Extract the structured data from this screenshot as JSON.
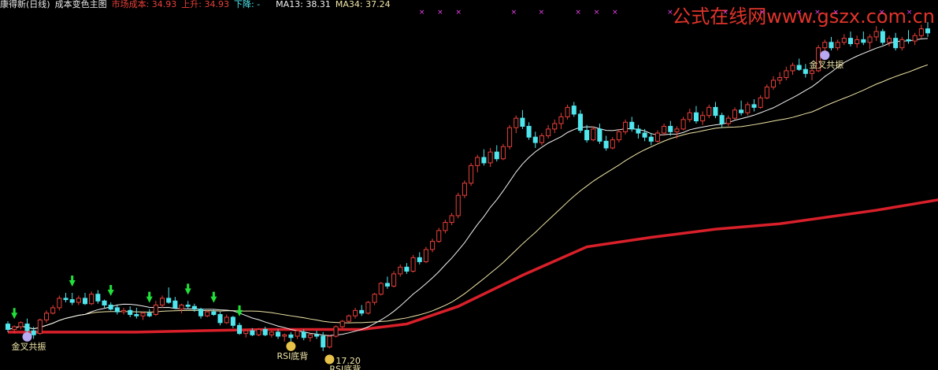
{
  "header": {
    "title": "康得新(日线)",
    "indicator_name": "成本变色主图",
    "market_cost": "市场成本: 34.93",
    "rise": "上升: 34.93",
    "fall": "下降: -",
    "ma13": "MA13: 38.31",
    "ma34": "MA34: 37.24"
  },
  "watermark": "公式在线网www.gszx.com.cn",
  "colors": {
    "background": "#000000",
    "up_candle": "#e8403a",
    "down_candle": "#4fe6ee",
    "ma13": "#f2f2f2",
    "ma34": "#f0e6a8",
    "cost_line": "#d9202a",
    "arrow": "#22e03a",
    "marker": "#ee44ee",
    "signal_text": "#f0e6a8"
  },
  "chart_data": {
    "type": "candlestick",
    "title": "康得新(日线)",
    "visible_y_range": [
      16.5,
      41.5
    ],
    "legend_values": {
      "market_cost": 34.93,
      "rise": 34.93,
      "fall": null,
      "ma13": 38.31,
      "ma34": 37.24
    },
    "cost_line_approx": [
      [
        0,
        18.6
      ],
      [
        20,
        18.6
      ],
      [
        40,
        18.8
      ],
      [
        55,
        18.8
      ],
      [
        62,
        19.2
      ],
      [
        70,
        20.5
      ],
      [
        80,
        22.8
      ],
      [
        90,
        24.9
      ],
      [
        100,
        25.6
      ],
      [
        110,
        26.2
      ],
      [
        120,
        26.6
      ],
      [
        135,
        27.6
      ],
      [
        145,
        28.4
      ],
      [
        155,
        29.6
      ],
      [
        165,
        30.5
      ],
      [
        173,
        31.0
      ]
    ],
    "signals": [
      {
        "label": "金叉共振",
        "index": 3
      },
      {
        "label": "RSI底背",
        "index": 44
      },
      {
        "label": "RSI底背",
        "index": 50
      },
      {
        "label": "金叉共振",
        "index": 127
      }
    ],
    "price_label": {
      "text": "17.20",
      "value": 17.2,
      "index": 50
    },
    "ohlc": [
      [
        19.2,
        19.4,
        18.6,
        18.8
      ],
      [
        18.8,
        19.1,
        18.5,
        19.0
      ],
      [
        19.0,
        19.4,
        18.8,
        19.3
      ],
      [
        19.2,
        19.6,
        18.6,
        18.7
      ],
      [
        18.7,
        19.0,
        18.1,
        18.4
      ],
      [
        18.5,
        19.6,
        18.4,
        19.5
      ],
      [
        19.5,
        20.2,
        19.3,
        20.0
      ],
      [
        20.0,
        20.6,
        19.9,
        20.4
      ],
      [
        20.4,
        21.3,
        20.2,
        21.1
      ],
      [
        21.1,
        21.5,
        20.8,
        21.0
      ],
      [
        21.0,
        21.5,
        20.6,
        20.8
      ],
      [
        20.8,
        21.3,
        20.6,
        21.1
      ],
      [
        21.1,
        21.5,
        20.6,
        20.7
      ],
      [
        20.7,
        21.6,
        20.6,
        21.4
      ],
      [
        21.4,
        21.7,
        20.7,
        20.9
      ],
      [
        20.9,
        21.0,
        20.4,
        20.6
      ],
      [
        20.6,
        20.8,
        20.2,
        20.3
      ],
      [
        20.4,
        20.6,
        19.9,
        20.1
      ],
      [
        20.1,
        20.4,
        19.9,
        20.2
      ],
      [
        20.2,
        20.5,
        19.7,
        19.9
      ],
      [
        19.9,
        20.4,
        19.6,
        19.8
      ],
      [
        19.8,
        20.1,
        19.5,
        20.0
      ],
      [
        20.0,
        20.3,
        19.7,
        19.8
      ],
      [
        19.9,
        20.9,
        19.8,
        20.6
      ],
      [
        20.6,
        21.3,
        20.4,
        21.1
      ],
      [
        21.1,
        21.9,
        20.7,
        20.8
      ],
      [
        20.9,
        21.2,
        20.3,
        20.4
      ],
      [
        20.3,
        20.7,
        20.0,
        20.6
      ],
      [
        20.6,
        20.9,
        20.3,
        20.5
      ],
      [
        20.5,
        20.7,
        20.1,
        20.3
      ],
      [
        20.3,
        20.4,
        19.6,
        19.8
      ],
      [
        19.8,
        20.2,
        19.7,
        20.1
      ],
      [
        20.1,
        20.3,
        19.8,
        19.9
      ],
      [
        19.9,
        20.1,
        19.1,
        19.3
      ],
      [
        19.3,
        19.9,
        19.2,
        19.7
      ],
      [
        19.7,
        19.8,
        18.9,
        19.1
      ],
      [
        19.1,
        19.3,
        18.4,
        18.5
      ],
      [
        18.5,
        18.8,
        18.2,
        18.7
      ],
      [
        18.7,
        18.9,
        18.3,
        18.4
      ],
      [
        18.4,
        18.9,
        18.3,
        18.8
      ],
      [
        18.8,
        19.0,
        18.3,
        18.4
      ],
      [
        18.4,
        18.7,
        18.2,
        18.6
      ],
      [
        18.6,
        18.8,
        18.1,
        18.3
      ],
      [
        18.3,
        18.5,
        17.9,
        18.4
      ],
      [
        18.4,
        18.6,
        17.9,
        18.2
      ],
      [
        18.3,
        18.8,
        18.1,
        18.7
      ],
      [
        18.6,
        18.8,
        18.0,
        18.2
      ],
      [
        18.2,
        18.5,
        17.9,
        18.4
      ],
      [
        18.4,
        18.7,
        18.1,
        18.3
      ],
      [
        18.3,
        18.6,
        17.2,
        17.5
      ],
      [
        17.5,
        18.4,
        17.4,
        18.3
      ],
      [
        18.3,
        19.1,
        18.2,
        19.0
      ],
      [
        19.0,
        19.5,
        18.9,
        19.4
      ],
      [
        19.4,
        19.9,
        19.3,
        19.8
      ],
      [
        19.8,
        20.4,
        19.6,
        20.2
      ],
      [
        20.2,
        20.6,
        19.8,
        20.0
      ],
      [
        20.0,
        20.9,
        19.9,
        20.8
      ],
      [
        20.8,
        21.5,
        20.6,
        21.4
      ],
      [
        21.4,
        22.3,
        21.3,
        22.2
      ],
      [
        22.2,
        22.7,
        21.8,
        22.0
      ],
      [
        22.0,
        23.1,
        21.9,
        22.9
      ],
      [
        22.9,
        23.6,
        22.7,
        23.4
      ],
      [
        23.4,
        23.7,
        22.9,
        23.1
      ],
      [
        23.1,
        24.3,
        23.0,
        24.1
      ],
      [
        24.1,
        24.5,
        23.6,
        23.8
      ],
      [
        23.8,
        24.9,
        23.7,
        24.7
      ],
      [
        24.7,
        25.5,
        24.5,
        25.3
      ],
      [
        25.3,
        26.3,
        25.2,
        26.1
      ],
      [
        26.1,
        26.9,
        25.9,
        26.7
      ],
      [
        26.7,
        27.4,
        26.5,
        27.2
      ],
      [
        27.2,
        28.9,
        27.0,
        28.7
      ],
      [
        28.7,
        29.8,
        28.5,
        29.6
      ],
      [
        29.6,
        31.1,
        29.4,
        30.9
      ],
      [
        30.9,
        31.7,
        30.4,
        31.5
      ],
      [
        31.5,
        32.1,
        30.9,
        31.1
      ],
      [
        31.1,
        32.2,
        30.8,
        31.9
      ],
      [
        31.9,
        32.4,
        31.2,
        31.4
      ],
      [
        31.4,
        32.5,
        31.3,
        32.3
      ],
      [
        32.3,
        33.9,
        32.1,
        33.7
      ],
      [
        33.7,
        34.6,
        33.3,
        34.4
      ],
      [
        34.4,
        35.0,
        33.6,
        33.8
      ],
      [
        33.8,
        34.1,
        32.8,
        33.0
      ],
      [
        33.0,
        33.4,
        32.2,
        32.6
      ],
      [
        32.6,
        33.3,
        32.4,
        33.1
      ],
      [
        33.1,
        33.9,
        32.9,
        33.6
      ],
      [
        33.6,
        34.3,
        33.3,
        34.0
      ],
      [
        34.0,
        34.8,
        33.6,
        34.5
      ],
      [
        34.5,
        35.4,
        34.3,
        35.2
      ],
      [
        35.3,
        35.6,
        34.5,
        34.7
      ],
      [
        34.7,
        35.0,
        33.3,
        33.5
      ],
      [
        33.5,
        33.9,
        32.6,
        32.8
      ],
      [
        32.8,
        33.8,
        32.7,
        33.6
      ],
      [
        33.6,
        34.0,
        32.5,
        32.7
      ],
      [
        32.7,
        33.1,
        32.0,
        32.2
      ],
      [
        32.2,
        33.0,
        32.1,
        32.8
      ],
      [
        32.8,
        33.6,
        32.6,
        33.4
      ],
      [
        33.4,
        34.3,
        33.2,
        34.1
      ],
      [
        34.1,
        34.5,
        33.4,
        33.6
      ],
      [
        33.6,
        33.9,
        32.9,
        33.3
      ],
      [
        33.3,
        33.6,
        32.7,
        33.0
      ],
      [
        33.0,
        33.3,
        32.4,
        32.7
      ],
      [
        32.7,
        33.5,
        32.6,
        33.3
      ],
      [
        33.3,
        34.0,
        33.1,
        33.8
      ],
      [
        33.8,
        34.2,
        33.1,
        33.4
      ],
      [
        33.4,
        33.8,
        32.9,
        33.6
      ],
      [
        33.6,
        34.5,
        33.5,
        34.3
      ],
      [
        34.3,
        35.1,
        34.1,
        34.8
      ],
      [
        34.8,
        35.3,
        34.0,
        34.2
      ],
      [
        34.2,
        34.9,
        33.9,
        34.6
      ],
      [
        34.6,
        35.4,
        34.4,
        35.2
      ],
      [
        35.2,
        35.6,
        34.4,
        34.6
      ],
      [
        34.6,
        34.8,
        33.7,
        34.0
      ],
      [
        34.0,
        34.6,
        33.8,
        34.4
      ],
      [
        34.4,
        35.2,
        34.3,
        35.0
      ],
      [
        35.0,
        35.7,
        34.6,
        34.8
      ],
      [
        34.8,
        35.6,
        34.6,
        35.4
      ],
      [
        35.4,
        35.8,
        34.9,
        35.2
      ],
      [
        35.2,
        36.1,
        35.1,
        35.9
      ],
      [
        35.9,
        36.9,
        35.8,
        36.7
      ],
      [
        36.7,
        37.5,
        36.5,
        37.2
      ],
      [
        37.2,
        37.8,
        36.9,
        37.4
      ],
      [
        37.4,
        38.2,
        37.2,
        37.9
      ],
      [
        37.9,
        38.5,
        37.6,
        38.3
      ],
      [
        38.3,
        38.8,
        37.9,
        38.0
      ],
      [
        38.0,
        38.4,
        37.4,
        37.7
      ],
      [
        37.7,
        38.1,
        37.2,
        37.9
      ],
      [
        37.9,
        39.8,
        37.8,
        39.6
      ],
      [
        39.6,
        40.2,
        39.4,
        40.0
      ],
      [
        40.0,
        40.4,
        39.4,
        39.6
      ],
      [
        39.6,
        40.2,
        39.4,
        40.0
      ],
      [
        40.0,
        40.6,
        39.8,
        40.3
      ],
      [
        40.3,
        40.8,
        39.7,
        39.9
      ],
      [
        39.9,
        40.5,
        39.6,
        40.2
      ],
      [
        40.2,
        40.8,
        39.8,
        40.0
      ],
      [
        40.0,
        40.6,
        39.5,
        40.4
      ],
      [
        40.4,
        41.2,
        40.1,
        40.8
      ],
      [
        40.8,
        41.0,
        39.8,
        40.0
      ],
      [
        40.0,
        40.5,
        39.7,
        40.3
      ],
      [
        40.3,
        40.7,
        39.4,
        39.6
      ],
      [
        39.6,
        40.4,
        39.4,
        40.2
      ],
      [
        40.2,
        40.9,
        39.9,
        40.1
      ],
      [
        40.1,
        40.7,
        39.8,
        40.5
      ],
      [
        40.5,
        41.3,
        40.3,
        41.0
      ],
      [
        41.0,
        41.5,
        40.4,
        40.7
      ]
    ]
  }
}
